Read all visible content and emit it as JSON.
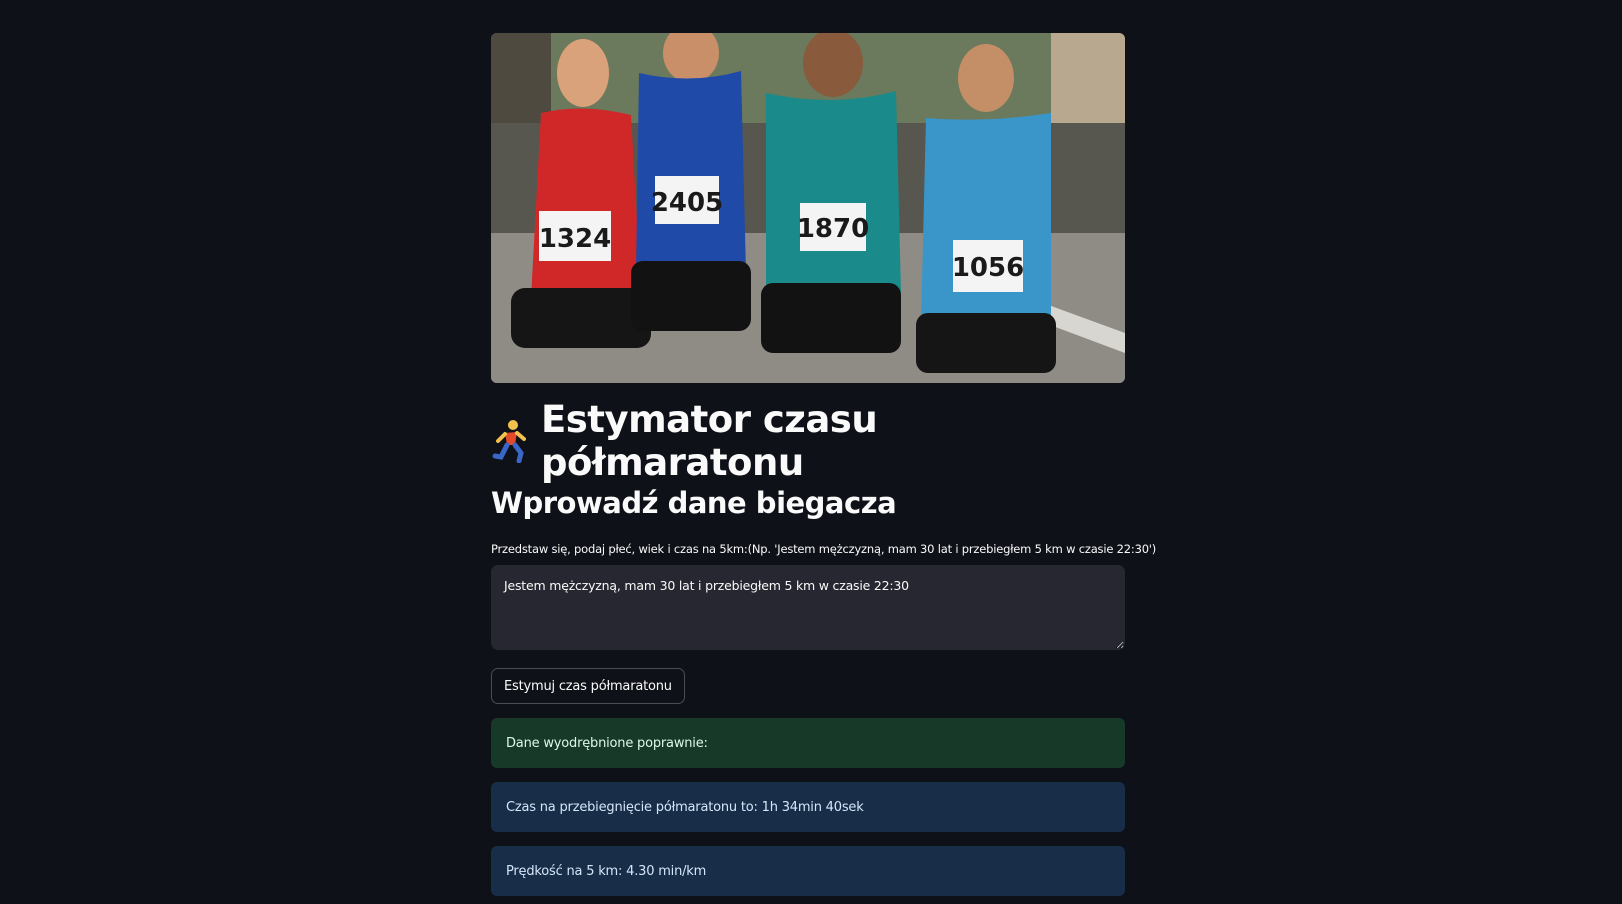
{
  "hero": {
    "bib_numbers": [
      "1324",
      "2405",
      "1870",
      "1056"
    ]
  },
  "page": {
    "title_icon": "running-person-icon",
    "title": "Estymator czasu półmaratonu",
    "subtitle": "Wprowadź dane biegacza"
  },
  "form": {
    "label": "Przedstaw się, podaj płeć, wiek i czas na 5km:(Np. 'Jestem mężczyzną, mam 30 lat i przebiegłem 5 km w czasie 22:30')",
    "input_value": "Jestem mężczyzną, mam 30 lat i przebiegłem 5 km w czasie 22:30",
    "button_label": "Estymuj czas półmaratonu"
  },
  "results": {
    "success_message": "Dane wyodrębnione poprawnie:",
    "time_message": "Czas na przebiegnięcie półmaratonu to: 1h 34min 40sek",
    "pace_message": "Prędkość na 5 km: 4.30 min/km"
  },
  "colors": {
    "background": "#0e1117",
    "input_bg": "#262730",
    "success_bg": "#173928",
    "info_bg": "#172d48"
  }
}
